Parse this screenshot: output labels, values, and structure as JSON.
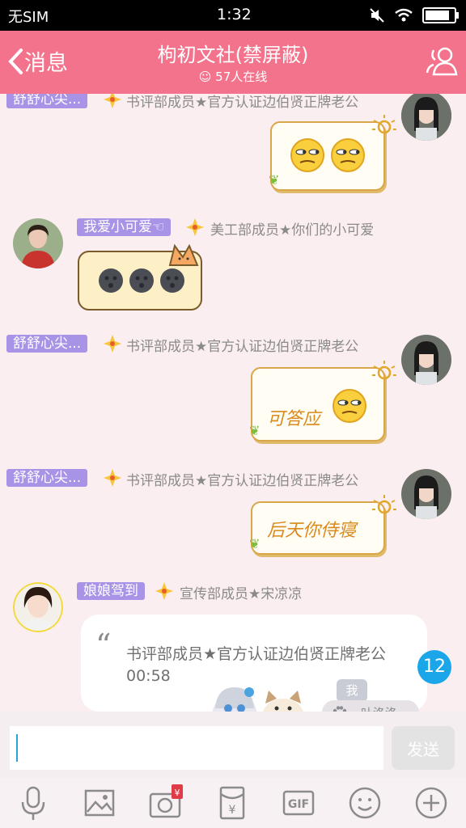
{
  "status_bar": {
    "carrier": "无SIM",
    "time": "1:32",
    "battery_level": 0.95
  },
  "nav": {
    "back_label": "消息",
    "title": "枸初文社(禁屏蔽)",
    "online": "57人在线"
  },
  "messages": [
    {
      "name": "舒舒心尖...",
      "title": "书评部成员★官方认证边伯贤正牌老公",
      "content": "😑😑"
    },
    {
      "name": "我爱小可爱☜",
      "title": "美工部成员★你们的小可爱",
      "content": "🌚🌚🌚"
    },
    {
      "name": "舒舒心尖...",
      "title": "书评部成员★官方认证边伯贤正牌老公",
      "text": "可答应"
    },
    {
      "name": "舒舒心尖...",
      "title": "书评部成员★官方认证边伯贤正牌老公",
      "text": "后天你侍寝"
    },
    {
      "name": "娘娘驾到",
      "title": "宣传部成员★宋凉凉",
      "quote_mark": "“",
      "quote": "书评部成员★官方认证边伯贤正牌老公 00:58"
    }
  ],
  "unread_badge": "12",
  "mini_cards": {
    "me_label": "我",
    "user_label": "叶洛洛"
  },
  "input": {
    "placeholder": "",
    "send_label": "发送"
  },
  "toolbar": [
    "mic-icon",
    "image-icon",
    "camera-icon",
    "red-packet-icon",
    "gif-icon",
    "emoji-icon",
    "plus-icon"
  ],
  "colors": {
    "nav": "#f4738c",
    "name_badge": "#a893e6",
    "background": "#fbeef0",
    "unread": "#1aa6e8"
  }
}
